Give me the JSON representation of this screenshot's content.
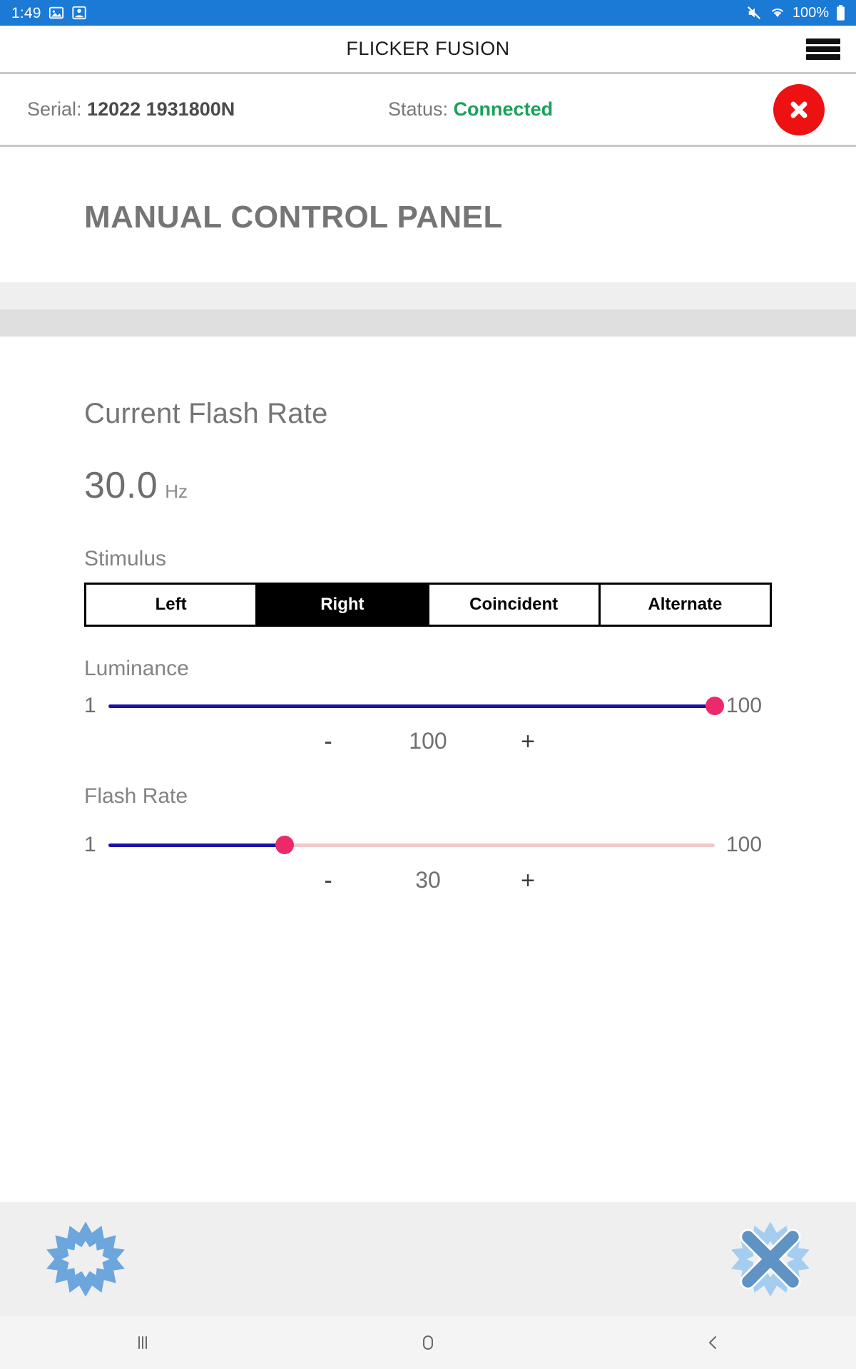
{
  "status_bar": {
    "time": "1:49",
    "battery_percent": "100%",
    "icons": [
      "image-icon",
      "screenshot-icon",
      "mute-icon",
      "wifi-icon",
      "battery-icon"
    ]
  },
  "header": {
    "title": "FLICKER FUSION",
    "menu_icon": "hamburger-menu-icon"
  },
  "device_bar": {
    "serial_label": "Serial:",
    "serial_value": "12022 1931800N",
    "status_label": "Status:",
    "status_value": "Connected",
    "status_color": "#1aa05a",
    "disconnect_icon": "close-x-icon",
    "disconnect_color": "#ee1111"
  },
  "panel": {
    "title": "MANUAL CONTROL PANEL"
  },
  "current_rate": {
    "label": "Current Flash Rate",
    "value": "30.0",
    "unit": "Hz"
  },
  "stimulus": {
    "label": "Stimulus",
    "options": [
      {
        "label": "Left",
        "selected": false
      },
      {
        "label": "Right",
        "selected": true
      },
      {
        "label": "Coincident",
        "selected": false
      },
      {
        "label": "Alternate",
        "selected": false
      }
    ],
    "selected": "Right"
  },
  "luminance": {
    "label": "Luminance",
    "min_label": "1",
    "max_label": "100",
    "value": "100",
    "min": 1,
    "max": 100,
    "decrement_label": "-",
    "increment_label": "+",
    "fill_percent": 100
  },
  "flash_rate": {
    "label": "Flash Rate",
    "min_label": "1",
    "max_label": "100",
    "value": "30",
    "min": 1,
    "max": 100,
    "decrement_label": "-",
    "increment_label": "+",
    "fill_percent": 29
  },
  "action_bar": {
    "start_icon": "starburst-flash-icon",
    "stop_icon": "starburst-stop-x-icon",
    "accent_color": "#6da6dc"
  },
  "nav_bar": {
    "recents_icon": "recents-icon",
    "home_icon": "home-circle-icon",
    "back_icon": "back-chevron-icon"
  }
}
